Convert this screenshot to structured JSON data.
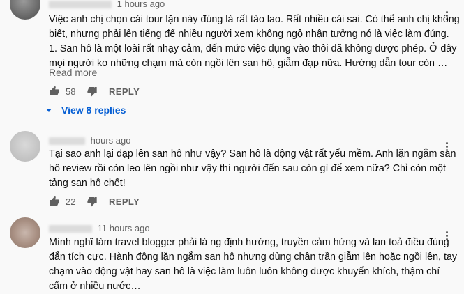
{
  "comments": [
    {
      "time": "1 hours ago",
      "lines": [
        "Việc anh chị chọn cái tour lặn này đúng là rất tào lao. Rất nhiều cái sai. Có thể anh chị không",
        "biết, nhưng phải lên tiếng để nhiều người xem không ngộ nhận tưởng nó là việc làm đúng.",
        "1. San hô là một loài rất nhạy cảm, đến mức việc đụng vào thôi đã không được phép. Ở đây",
        "mọi người ko những chạm mà còn ngồi lên san hô, giẫm đạp nữa. Hướng dẫn tour còn …"
      ],
      "read_more": "Read more",
      "likes": "58",
      "reply_label": "REPLY",
      "view_replies": "View 8 replies"
    },
    {
      "time": "hours ago",
      "lines": [
        "Tại sao anh lại đạp lên san hô như vậy? San hô là động vật rất yếu mềm. Anh lặn ngắm san",
        "hô review rồi còn leo lên ngồi như vậy thì người đến sau còn gì để xem nữa? Chỉ còn một",
        "tảng san hô chết!"
      ],
      "likes": "22",
      "reply_label": "REPLY"
    },
    {
      "time": "11 hours ago",
      "lines": [
        "Mình nghĩ làm travel blogger phải là ng định hướng, truyền cảm hứng và lan toả điều đúng",
        "đắn tích cực. Hành động lặn ngắm san hô nhưng dùng chân trần giẫm lên hoặc ngồi lên, tay",
        "chạm vào động vật hay san hô là việc làm luôn luôn không được khuyến khích, thậm chí",
        "cấm ở nhiều nước…"
      ]
    }
  ],
  "icons": {
    "like": "thumbs-up-icon",
    "dislike": "thumbs-down-icon",
    "menu": "more-vertical-icon",
    "expand": "caret-down-icon"
  },
  "colors": {
    "link_blue": "#065fd4",
    "secondary_text": "#606060",
    "background": "#f9f9f9"
  }
}
